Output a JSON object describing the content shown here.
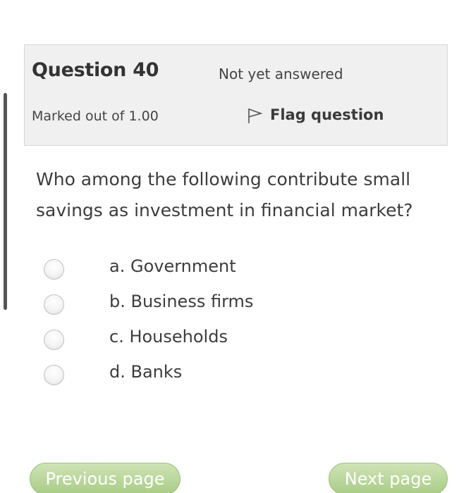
{
  "question": {
    "number_label": "Question 40",
    "state": "Not yet answered",
    "grade": "Marked out of 1.00",
    "flag_label": "Flag question",
    "text": "Who among the following contribute small savings as investment in financial market?"
  },
  "answers": [
    {
      "label": "a. Government"
    },
    {
      "label": "b. Business firms"
    },
    {
      "label": "c. Households"
    },
    {
      "label": "d. Banks"
    }
  ],
  "navigation": {
    "previous_label": "Previous page",
    "next_label": "Next page"
  },
  "colors": {
    "info_box_bg": "#f0f0f0",
    "button_green": "#a9cc86"
  },
  "icons": {
    "flag": "flag-icon"
  }
}
